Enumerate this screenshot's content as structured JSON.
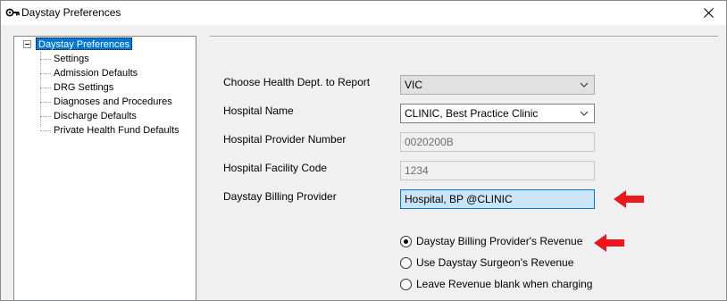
{
  "window": {
    "title": "Daystay Preferences",
    "close_glyph": "×"
  },
  "tree": {
    "root_label": "Daystay Preferences",
    "items": [
      {
        "label": "Settings"
      },
      {
        "label": "Admission Defaults"
      },
      {
        "label": "DRG Settings"
      },
      {
        "label": "Diagnoses and Procedures"
      },
      {
        "label": "Discharge Defaults"
      },
      {
        "label": "Private Health Fund Defaults"
      }
    ]
  },
  "form": {
    "health_dept": {
      "label": "Choose Health Dept. to Report",
      "value": "VIC"
    },
    "hospital_name": {
      "label": "Hospital Name",
      "value": "CLINIC, Best Practice Clinic"
    },
    "provider_number": {
      "label": "Hospital Provider Number",
      "value": "0020200B"
    },
    "facility_code": {
      "label": "Hospital Facility Code",
      "value": "1234"
    },
    "billing_provider": {
      "label": "Daystay Billing Provider",
      "value": "Hospital, BP @CLINIC"
    }
  },
  "revenue_options": [
    {
      "label": "Daystay Billing Provider's Revenue",
      "checked": true
    },
    {
      "label": "Use Daystay Surgeon's Revenue",
      "checked": false
    },
    {
      "label": "Leave Revenue blank when charging",
      "checked": false
    }
  ],
  "colors": {
    "annotation_arrow": "#e8191c",
    "selection": "#0078d7"
  },
  "icons": {
    "title": "key-icon",
    "close": "close-icon",
    "dropdown": "chevron-down-icon",
    "annotation": "arrow-left-icon"
  }
}
